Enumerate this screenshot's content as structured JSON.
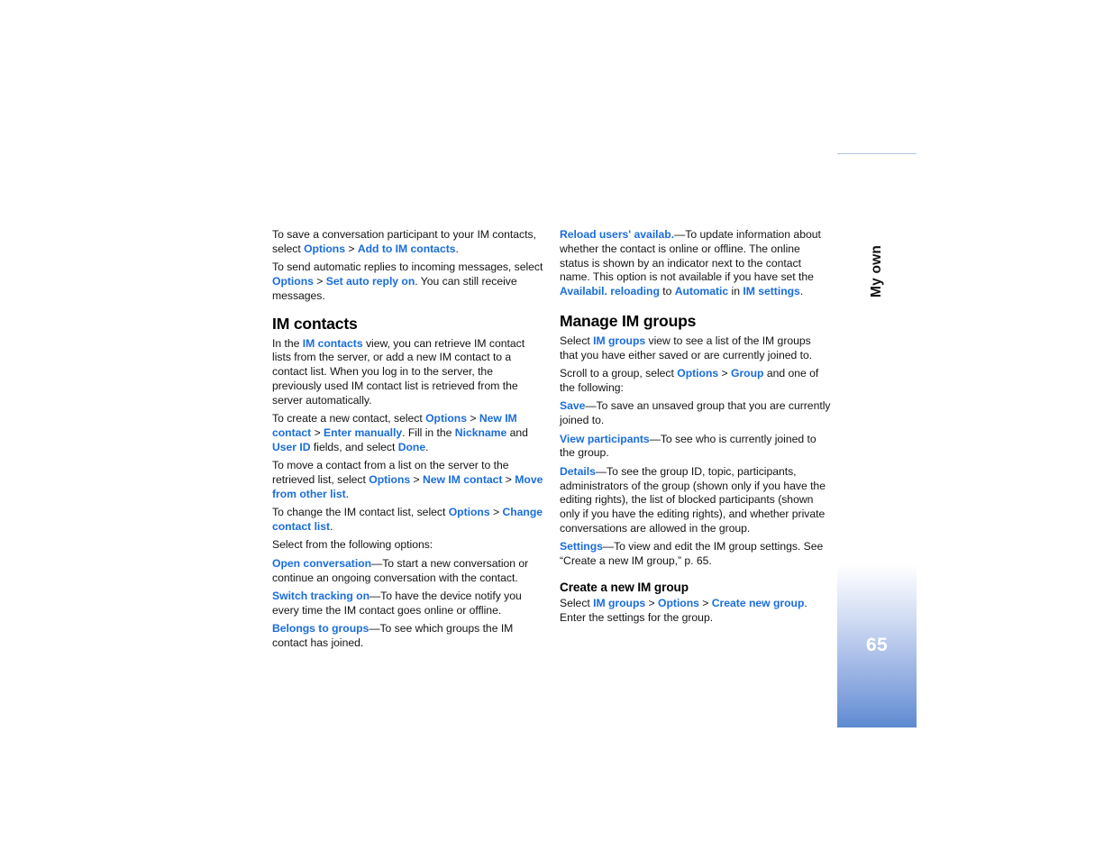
{
  "page": {
    "number": "65",
    "tab_label": "My own",
    "tab_accent": "#2a71be",
    "link_color": "#1a6ddb"
  },
  "left_column": {
    "p1": {
      "t1": "To save a conversation participant to your IM contacts, select ",
      "l1": "Options",
      "t2": " > ",
      "l2": "Add to IM contacts",
      "t3": "."
    },
    "p2": {
      "t1": "To send automatic replies to incoming messages, select ",
      "l1": "Options",
      "t2": " > ",
      "l2": "Set auto reply on",
      "t3": ". You can still receive messages."
    },
    "heading": "IM contacts",
    "p3": {
      "t1": "In the ",
      "l1": "IM contacts",
      "t2": " view, you can retrieve IM contact lists from the server, or add a new IM contact to a contact list. When you log in to the server, the previously used IM contact list is retrieved from the server automatically."
    },
    "p4": {
      "t1": "To create a new contact, select ",
      "l1": "Options",
      "t2": " > ",
      "l2": "New IM contact",
      "t3": " > ",
      "l3": "Enter manually",
      "t4": ". Fill in the ",
      "l4": "Nickname",
      "t5": " and ",
      "l5": "User ID",
      "t6": " fields, and select ",
      "l6": "Done",
      "t7": "."
    },
    "p5": {
      "t1": "To move a contact from a list on the server to the retrieved list, select ",
      "l1": "Options",
      "t2": " > ",
      "l2": "New IM contact",
      "t3": " > ",
      "l3": "Move from other list",
      "t4": "."
    },
    "p6": {
      "t1": "To change the IM contact list, select ",
      "l1": "Options",
      "t2": " > ",
      "l2": "Change contact list",
      "t3": "."
    },
    "p7": {
      "t1": "Select from the following options:"
    },
    "p8": {
      "l1": "Open conversation",
      "t1": "—To start a new conversation or continue an ongoing conversation with the contact."
    },
    "p9": {
      "l1": "Switch tracking on",
      "t1": "—To have the device notify you every time the IM contact goes online or offline."
    },
    "p10": {
      "l1": "Belongs to groups",
      "t1": "—To see which groups the IM contact has joined."
    }
  },
  "right_column": {
    "p1": {
      "l1": "Reload users' availab.",
      "t1": "—To update information about whether the contact is online or offline. The online status is shown by an indicator next to the contact name. This option is not available if you have set the ",
      "l2": "Availabil. reloading",
      "t2": " to ",
      "l3": "Automatic",
      "t3": " in ",
      "l4": "IM settings",
      "t4": "."
    },
    "heading": "Manage IM groups",
    "p2": {
      "t1": "Select ",
      "l1": "IM groups",
      "t2": " view to see a list of the IM groups that you have either saved or are currently joined to."
    },
    "p3": {
      "t1": "Scroll to a group, select ",
      "l1": "Options",
      "t2": " > ",
      "l2": "Group",
      "t3": " and one of the following:"
    },
    "p4": {
      "l1": "Save",
      "t1": "—To save an unsaved group that you are currently joined to."
    },
    "p5": {
      "l1": "View participants",
      "t1": "—To see who is currently joined to the group."
    },
    "p6": {
      "l1": "Details",
      "t1": "—To see the group ID, topic, participants, administrators of the group (shown only if you have the editing rights), the list of blocked participants (shown only if you have the editing rights), and whether private conversations are allowed in the group."
    },
    "p7": {
      "l1": "Settings",
      "t1": "—To view and edit the IM group settings. See “Create a new IM group,” p. 65."
    },
    "subheading": "Create a new IM group",
    "p8": {
      "t1": "Select ",
      "l1": "IM groups",
      "t2": " > ",
      "l2": "Options",
      "t3": " > ",
      "l3": "Create new group",
      "t4": ". Enter the settings for the group."
    }
  }
}
